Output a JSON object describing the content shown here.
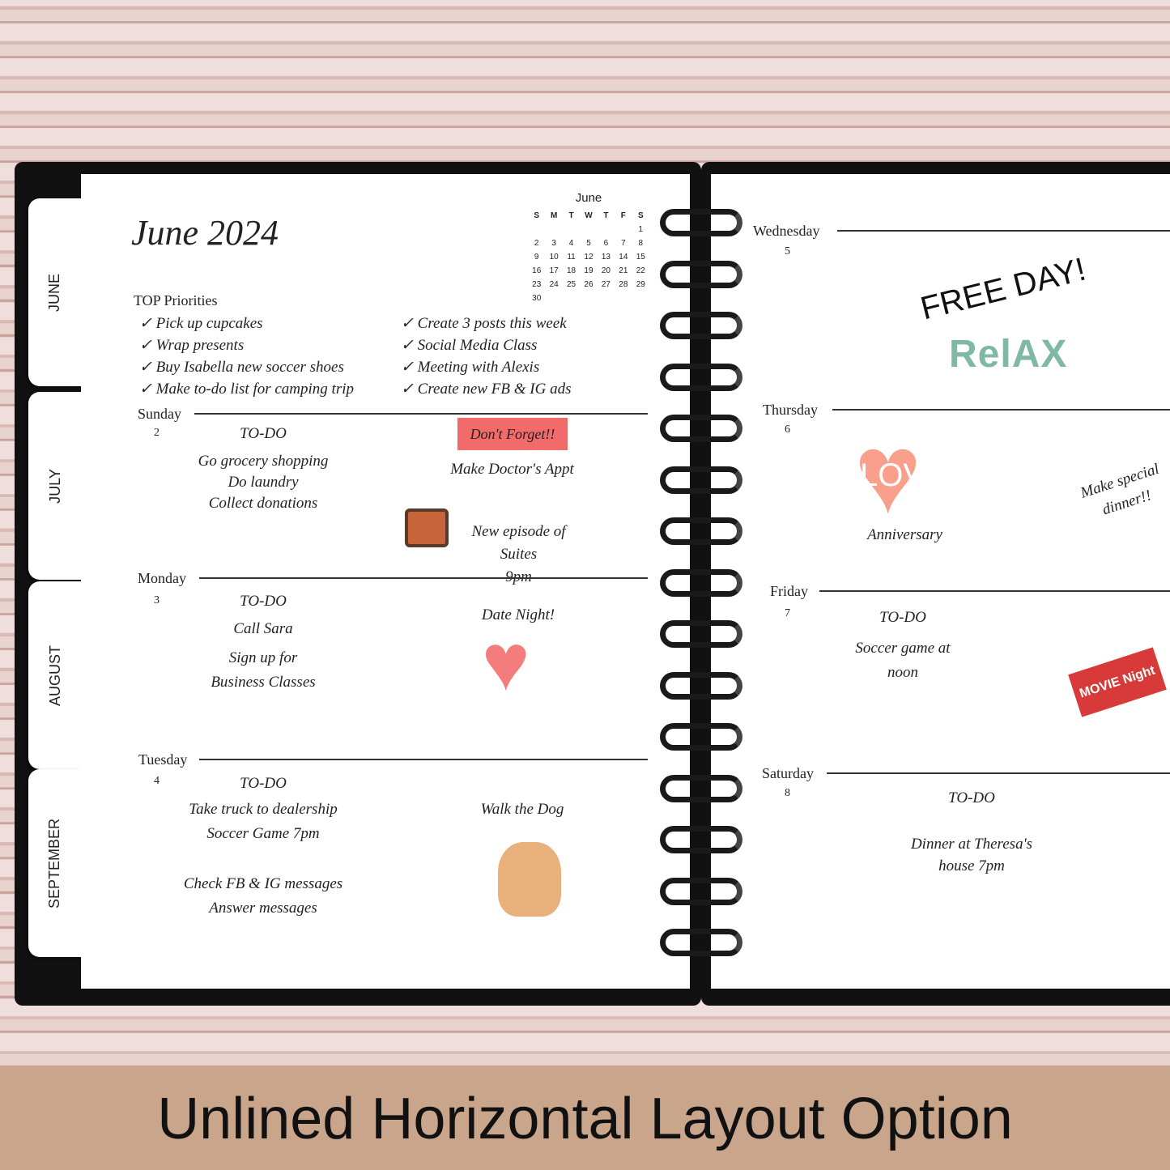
{
  "tabs": [
    "JUNE",
    "JULY",
    "AUGUST",
    "SEPTEMBER"
  ],
  "title": "June 2024",
  "mini_calendar": {
    "month": "June",
    "weekdays": [
      "S",
      "M",
      "T",
      "W",
      "T",
      "F",
      "S"
    ],
    "days": [
      "",
      "",
      "",
      "",
      "",
      "",
      "1",
      "2",
      "3",
      "4",
      "5",
      "6",
      "7",
      "8",
      "9",
      "10",
      "11",
      "12",
      "13",
      "14",
      "15",
      "16",
      "17",
      "18",
      "19",
      "20",
      "21",
      "22",
      "23",
      "24",
      "25",
      "26",
      "27",
      "28",
      "29",
      "30"
    ]
  },
  "priorities": {
    "heading": "TOP Priorities",
    "left": [
      "Pick up cupcakes",
      "Wrap presents",
      "Buy Isabella new soccer shoes",
      "Make to-do list for camping trip"
    ],
    "right": [
      "Create 3 posts this week",
      "Social Media Class",
      "Meeting with Alexis",
      "Create new FB & IG ads"
    ]
  },
  "days": {
    "sunday": {
      "name": "Sunday",
      "num": "2",
      "todo": "TO-DO",
      "items": [
        "Go grocery shopping",
        "Do laundry",
        "Collect donations"
      ],
      "sticker": "Don't Forget!!",
      "note": "Make Doctor's Appt",
      "tv_note": "New episode of Suites",
      "tv_time": "9pm"
    },
    "monday": {
      "name": "Monday",
      "num": "3",
      "todo": "TO-DO",
      "items": [
        "Call Sara",
        "Sign up for",
        "Business Classes"
      ],
      "note": "Date Night!"
    },
    "tuesday": {
      "name": "Tuesday",
      "num": "4",
      "todo": "TO-DO",
      "items": [
        "Take truck to dealership",
        "Soccer Game 7pm",
        "Check FB & IG messages",
        "Answer messages"
      ],
      "note": "Walk the Dog"
    },
    "wednesday": {
      "name": "Wednesday",
      "num": "5",
      "note": "FREE DAY!",
      "sticker": "RelAX"
    },
    "thursday": {
      "name": "Thursday",
      "num": "6",
      "sticker": "LOVE",
      "note": "Anniversary",
      "side_note": "Make special dinner!!"
    },
    "friday": {
      "name": "Friday",
      "num": "7",
      "todo": "TO-DO",
      "items": [
        "Soccer game at",
        "noon"
      ],
      "sticker": "MOVIE Night"
    },
    "saturday": {
      "name": "Saturday",
      "num": "8",
      "todo": "TO-DO",
      "items": [
        "Dinner at Theresa's",
        "house 7pm"
      ]
    }
  },
  "banner": "Unlined Horizontal Layout Option",
  "colors": {
    "cover": "#111111",
    "banner": "#c9a58b",
    "heart": "#f47c7c",
    "sticker": "#f26b6b"
  }
}
